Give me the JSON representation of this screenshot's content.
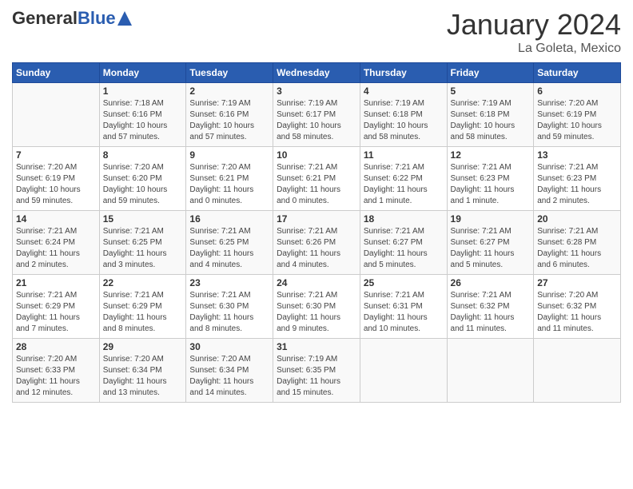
{
  "header": {
    "logo_general": "General",
    "logo_blue": "Blue",
    "month_title": "January 2024",
    "location": "La Goleta, Mexico"
  },
  "days_of_week": [
    "Sunday",
    "Monday",
    "Tuesday",
    "Wednesday",
    "Thursday",
    "Friday",
    "Saturday"
  ],
  "weeks": [
    [
      {
        "day": "",
        "info": ""
      },
      {
        "day": "1",
        "info": "Sunrise: 7:18 AM\nSunset: 6:16 PM\nDaylight: 10 hours\nand 57 minutes."
      },
      {
        "day": "2",
        "info": "Sunrise: 7:19 AM\nSunset: 6:16 PM\nDaylight: 10 hours\nand 57 minutes."
      },
      {
        "day": "3",
        "info": "Sunrise: 7:19 AM\nSunset: 6:17 PM\nDaylight: 10 hours\nand 58 minutes."
      },
      {
        "day": "4",
        "info": "Sunrise: 7:19 AM\nSunset: 6:18 PM\nDaylight: 10 hours\nand 58 minutes."
      },
      {
        "day": "5",
        "info": "Sunrise: 7:19 AM\nSunset: 6:18 PM\nDaylight: 10 hours\nand 58 minutes."
      },
      {
        "day": "6",
        "info": "Sunrise: 7:20 AM\nSunset: 6:19 PM\nDaylight: 10 hours\nand 59 minutes."
      }
    ],
    [
      {
        "day": "7",
        "info": "Sunrise: 7:20 AM\nSunset: 6:19 PM\nDaylight: 10 hours\nand 59 minutes."
      },
      {
        "day": "8",
        "info": "Sunrise: 7:20 AM\nSunset: 6:20 PM\nDaylight: 10 hours\nand 59 minutes."
      },
      {
        "day": "9",
        "info": "Sunrise: 7:20 AM\nSunset: 6:21 PM\nDaylight: 11 hours\nand 0 minutes."
      },
      {
        "day": "10",
        "info": "Sunrise: 7:21 AM\nSunset: 6:21 PM\nDaylight: 11 hours\nand 0 minutes."
      },
      {
        "day": "11",
        "info": "Sunrise: 7:21 AM\nSunset: 6:22 PM\nDaylight: 11 hours\nand 1 minute."
      },
      {
        "day": "12",
        "info": "Sunrise: 7:21 AM\nSunset: 6:23 PM\nDaylight: 11 hours\nand 1 minute."
      },
      {
        "day": "13",
        "info": "Sunrise: 7:21 AM\nSunset: 6:23 PM\nDaylight: 11 hours\nand 2 minutes."
      }
    ],
    [
      {
        "day": "14",
        "info": "Sunrise: 7:21 AM\nSunset: 6:24 PM\nDaylight: 11 hours\nand 2 minutes."
      },
      {
        "day": "15",
        "info": "Sunrise: 7:21 AM\nSunset: 6:25 PM\nDaylight: 11 hours\nand 3 minutes."
      },
      {
        "day": "16",
        "info": "Sunrise: 7:21 AM\nSunset: 6:25 PM\nDaylight: 11 hours\nand 4 minutes."
      },
      {
        "day": "17",
        "info": "Sunrise: 7:21 AM\nSunset: 6:26 PM\nDaylight: 11 hours\nand 4 minutes."
      },
      {
        "day": "18",
        "info": "Sunrise: 7:21 AM\nSunset: 6:27 PM\nDaylight: 11 hours\nand 5 minutes."
      },
      {
        "day": "19",
        "info": "Sunrise: 7:21 AM\nSunset: 6:27 PM\nDaylight: 11 hours\nand 5 minutes."
      },
      {
        "day": "20",
        "info": "Sunrise: 7:21 AM\nSunset: 6:28 PM\nDaylight: 11 hours\nand 6 minutes."
      }
    ],
    [
      {
        "day": "21",
        "info": "Sunrise: 7:21 AM\nSunset: 6:29 PM\nDaylight: 11 hours\nand 7 minutes."
      },
      {
        "day": "22",
        "info": "Sunrise: 7:21 AM\nSunset: 6:29 PM\nDaylight: 11 hours\nand 8 minutes."
      },
      {
        "day": "23",
        "info": "Sunrise: 7:21 AM\nSunset: 6:30 PM\nDaylight: 11 hours\nand 8 minutes."
      },
      {
        "day": "24",
        "info": "Sunrise: 7:21 AM\nSunset: 6:30 PM\nDaylight: 11 hours\nand 9 minutes."
      },
      {
        "day": "25",
        "info": "Sunrise: 7:21 AM\nSunset: 6:31 PM\nDaylight: 11 hours\nand 10 minutes."
      },
      {
        "day": "26",
        "info": "Sunrise: 7:21 AM\nSunset: 6:32 PM\nDaylight: 11 hours\nand 11 minutes."
      },
      {
        "day": "27",
        "info": "Sunrise: 7:20 AM\nSunset: 6:32 PM\nDaylight: 11 hours\nand 11 minutes."
      }
    ],
    [
      {
        "day": "28",
        "info": "Sunrise: 7:20 AM\nSunset: 6:33 PM\nDaylight: 11 hours\nand 12 minutes."
      },
      {
        "day": "29",
        "info": "Sunrise: 7:20 AM\nSunset: 6:34 PM\nDaylight: 11 hours\nand 13 minutes."
      },
      {
        "day": "30",
        "info": "Sunrise: 7:20 AM\nSunset: 6:34 PM\nDaylight: 11 hours\nand 14 minutes."
      },
      {
        "day": "31",
        "info": "Sunrise: 7:19 AM\nSunset: 6:35 PM\nDaylight: 11 hours\nand 15 minutes."
      },
      {
        "day": "",
        "info": ""
      },
      {
        "day": "",
        "info": ""
      },
      {
        "day": "",
        "info": ""
      }
    ]
  ]
}
